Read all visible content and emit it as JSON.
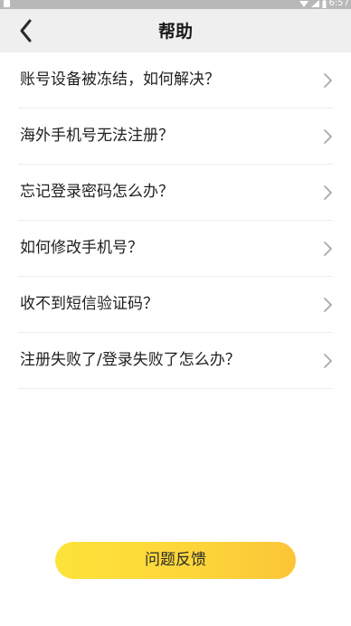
{
  "status_bar": {
    "time": "6:57"
  },
  "header": {
    "title": "帮助"
  },
  "faq": {
    "items": [
      {
        "label": "账号设备被冻结，如何解决？"
      },
      {
        "label": "海外手机号无法注册？"
      },
      {
        "label": "忘记登录密码怎么办？"
      },
      {
        "label": "如何修改手机号？"
      },
      {
        "label": "收不到短信验证码？"
      },
      {
        "label": "注册失败了/登录失败了怎么办？"
      }
    ]
  },
  "footer": {
    "feedback_label": "问题反馈"
  },
  "colors": {
    "header_bg": "#efefef",
    "accent_yellow": "#fdd53a",
    "status_bar_bg": "#b8b8b8"
  }
}
